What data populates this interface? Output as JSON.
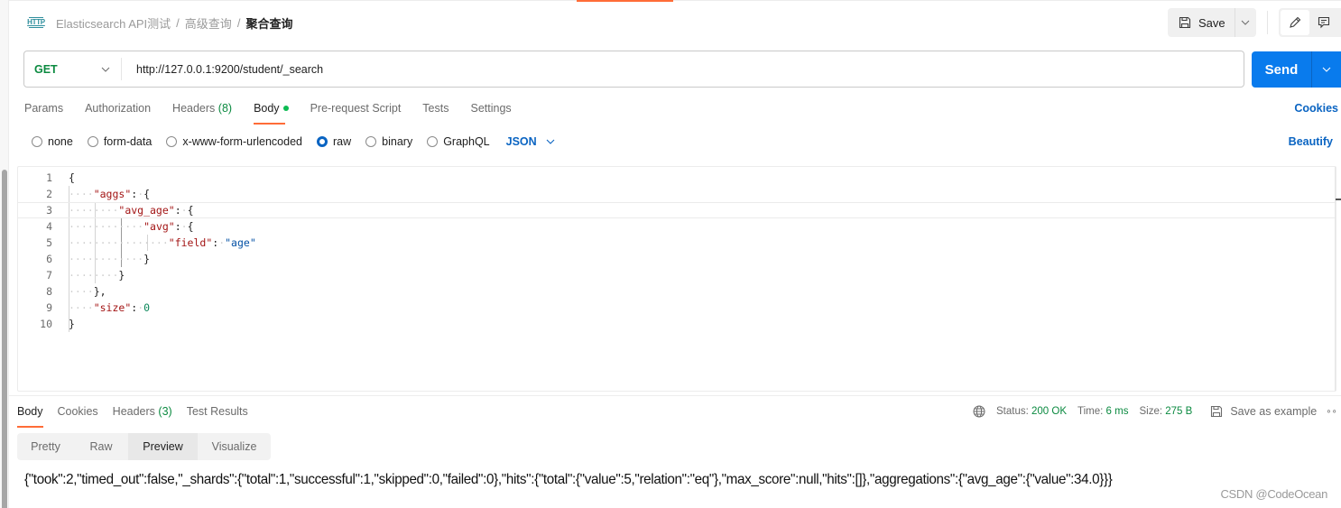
{
  "header": {
    "breadcrumb": [
      "Elasticsearch API测试",
      "高级查询"
    ],
    "current": "聚合查询",
    "separator": "/",
    "save_label": "Save"
  },
  "request": {
    "method": "GET",
    "url": "http://127.0.0.1:9200/student/_search",
    "send_label": "Send"
  },
  "tabs": {
    "params": "Params",
    "authorization": "Authorization",
    "headers": "Headers",
    "headers_count": "(8)",
    "body": "Body",
    "pre_request": "Pre-request Script",
    "tests": "Tests",
    "settings": "Settings",
    "cookies": "Cookies"
  },
  "body_types": {
    "none": "none",
    "form_data": "form-data",
    "urlencoded": "x-www-form-urlencoded",
    "raw": "raw",
    "binary": "binary",
    "graphql": "GraphQL",
    "selected": "raw",
    "format": "JSON",
    "beautify": "Beautify"
  },
  "editor": {
    "line_numbers": [
      "1",
      "2",
      "3",
      "4",
      "5",
      "6",
      "7",
      "8",
      "9",
      "10"
    ],
    "lines": [
      "{",
      "    \"aggs\": {",
      "        \"avg_age\": {",
      "            \"avg\": {",
      "                \"field\": \"age\"",
      "            }",
      "        }",
      "    },",
      "    \"size\": 0",
      "}"
    ]
  },
  "response": {
    "tabs": {
      "body": "Body",
      "cookies": "Cookies",
      "headers": "Headers",
      "headers_count": "(3)",
      "test_results": "Test Results"
    },
    "status_label": "Status:",
    "status_value": "200 OK",
    "time_label": "Time:",
    "time_value": "6 ms",
    "size_label": "Size:",
    "size_value": "275 B",
    "save_example": "Save as example",
    "view_tabs": [
      "Pretty",
      "Raw",
      "Preview",
      "Visualize"
    ],
    "active_view": "Preview",
    "body_text": "{\"took\":2,\"timed_out\":false,\"_shards\":{\"total\":1,\"successful\":1,\"skipped\":0,\"failed\":0},\"hits\":{\"total\":{\"value\":5,\"relation\":\"eq\"},\"max_score\":null,\"hits\":[]},\"aggregations\":{\"avg_age\":{\"value\":34.0}}}"
  },
  "watermark": "CSDN @CodeOcean",
  "colors": {
    "accent": "#ff6c37",
    "primary": "#097bed",
    "link": "#0a64c2",
    "success": "#0b8a40"
  }
}
